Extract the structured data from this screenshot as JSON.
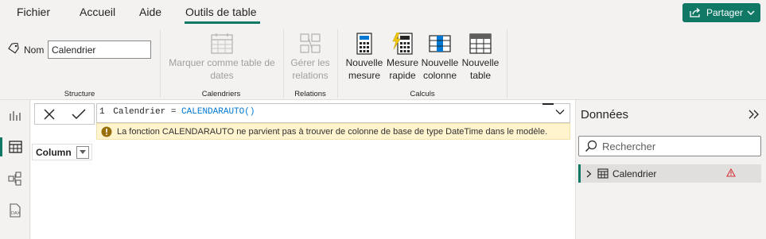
{
  "tabs": [
    {
      "label": "Fichier"
    },
    {
      "label": "Accueil"
    },
    {
      "label": "Aide"
    },
    {
      "label": "Outils de table"
    }
  ],
  "share": {
    "label": "Partager"
  },
  "ribbon": {
    "structure": {
      "name_label": "Nom",
      "name_value": "Calendrier",
      "group_label": "Structure"
    },
    "calendriers": {
      "button_label": "Marquer comme table de dates",
      "group_label": "Calendriers"
    },
    "relations": {
      "button_label": "Gérer les relations",
      "group_label": "Relations"
    },
    "calculs": {
      "group_label": "Calculs",
      "buttons": [
        {
          "label": "Nouvelle mesure"
        },
        {
          "label": "Mesure rapide"
        },
        {
          "label": "Nouvelle colonne"
        },
        {
          "label": "Nouvelle table"
        }
      ]
    }
  },
  "formula": {
    "line_number": "1",
    "prefix": "Calendrier = ",
    "function": "CALENDARAUTO()",
    "warning": "La fonction CALENDARAUTO ne parvient pas à trouver de colonne de base de type DateTime dans le modèle."
  },
  "grid": {
    "column_header": "Column"
  },
  "data_pane": {
    "title": "Données",
    "search_placeholder": "Rechercher",
    "items": [
      {
        "label": "Calendrier",
        "status": "warning"
      }
    ]
  },
  "colors": {
    "accent": "#117865",
    "warning": "#fff4ce",
    "warning_icon": "#d13438"
  }
}
